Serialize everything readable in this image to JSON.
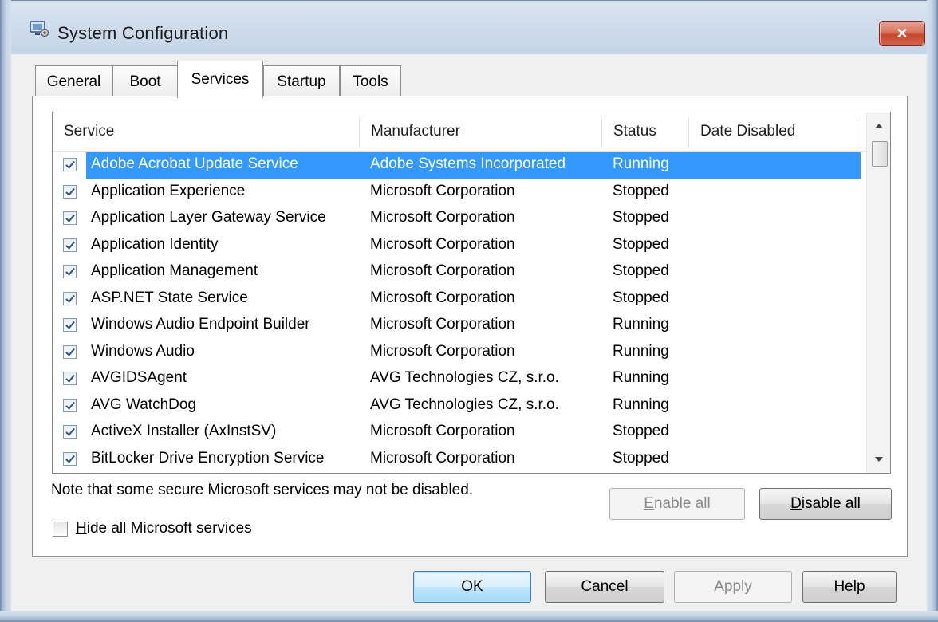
{
  "window": {
    "title": "System Configuration",
    "close_label": "✕"
  },
  "tabs": [
    {
      "label": "General",
      "active": false
    },
    {
      "label": "Boot",
      "active": false
    },
    {
      "label": "Services",
      "active": true
    },
    {
      "label": "Startup",
      "active": false
    },
    {
      "label": "Tools",
      "active": false
    }
  ],
  "list": {
    "columns": {
      "service": "Service",
      "manufacturer": "Manufacturer",
      "status": "Status",
      "date_disabled": "Date Disabled"
    },
    "rows": [
      {
        "checked": true,
        "service": "Adobe Acrobat Update Service",
        "manufacturer": "Adobe Systems Incorporated",
        "status": "Running",
        "date": "",
        "selected": true
      },
      {
        "checked": true,
        "service": "Application Experience",
        "manufacturer": "Microsoft Corporation",
        "status": "Stopped",
        "date": ""
      },
      {
        "checked": true,
        "service": "Application Layer Gateway Service",
        "manufacturer": "Microsoft Corporation",
        "status": "Stopped",
        "date": ""
      },
      {
        "checked": true,
        "service": "Application Identity",
        "manufacturer": "Microsoft Corporation",
        "status": "Stopped",
        "date": ""
      },
      {
        "checked": true,
        "service": "Application Management",
        "manufacturer": "Microsoft Corporation",
        "status": "Stopped",
        "date": ""
      },
      {
        "checked": true,
        "service": "ASP.NET State Service",
        "manufacturer": "Microsoft Corporation",
        "status": "Stopped",
        "date": ""
      },
      {
        "checked": true,
        "service": "Windows Audio Endpoint Builder",
        "manufacturer": "Microsoft Corporation",
        "status": "Running",
        "date": ""
      },
      {
        "checked": true,
        "service": "Windows Audio",
        "manufacturer": "Microsoft Corporation",
        "status": "Running",
        "date": ""
      },
      {
        "checked": true,
        "service": "AVGIDSAgent",
        "manufacturer": "AVG Technologies CZ, s.r.o.",
        "status": "Running",
        "date": ""
      },
      {
        "checked": true,
        "service": "AVG WatchDog",
        "manufacturer": "AVG Technologies CZ, s.r.o.",
        "status": "Running",
        "date": ""
      },
      {
        "checked": true,
        "service": "ActiveX Installer (AxInstSV)",
        "manufacturer": "Microsoft Corporation",
        "status": "Stopped",
        "date": ""
      },
      {
        "checked": true,
        "service": "BitLocker Drive Encryption Service",
        "manufacturer": "Microsoft Corporation",
        "status": "Stopped",
        "date": ""
      }
    ]
  },
  "note": "Note that some secure Microsoft services may not be disabled.",
  "buttons": {
    "enable_all": {
      "accel": "E",
      "rest": "nable all"
    },
    "disable_all": {
      "accel": "D",
      "rest": "isable all"
    },
    "ok": "OK",
    "cancel": "Cancel",
    "apply": {
      "accel": "A",
      "rest": "pply"
    },
    "help": "Help"
  },
  "hide_ms": {
    "accel": "H",
    "rest": "ide all Microsoft services",
    "checked": false
  }
}
